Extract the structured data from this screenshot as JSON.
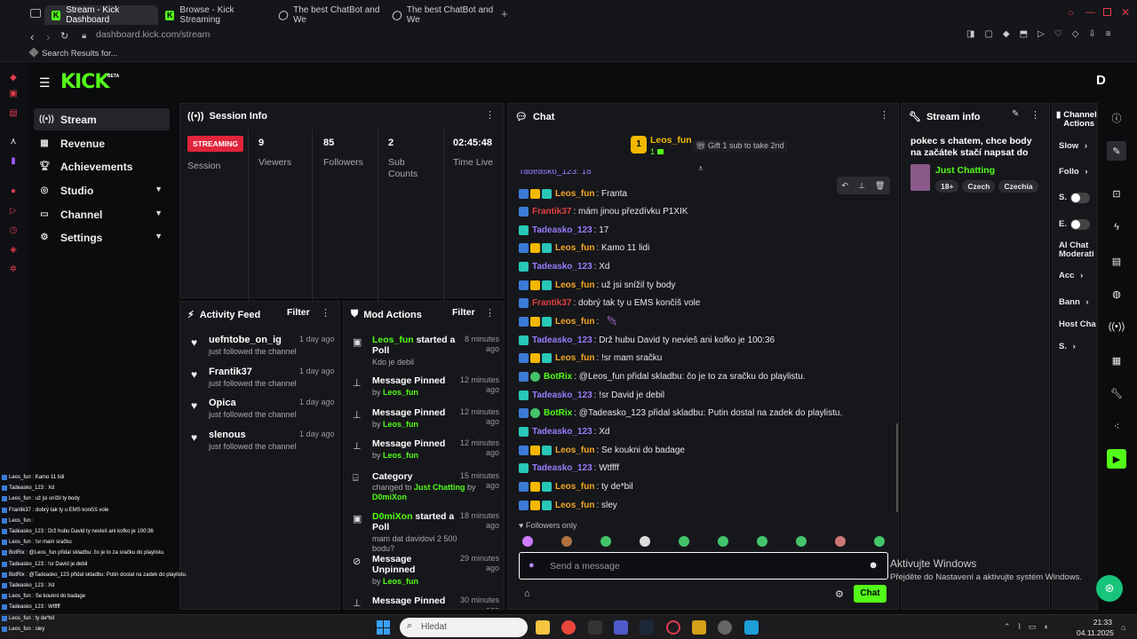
{
  "browser": {
    "tabs": [
      {
        "label": "Stream - Kick Dashboard",
        "active": true
      },
      {
        "label": "Browse - Kick Streaming",
        "active": false
      },
      {
        "label": "The best ChatBot and We",
        "active": false
      },
      {
        "label": "The best ChatBot and We",
        "active": false
      }
    ],
    "url_host": "dashboard.kick.com",
    "url_path": "/stream",
    "bookmark": "Search Results for..."
  },
  "header": {
    "logo": "KICK",
    "beta": "BETA",
    "avatar": "D"
  },
  "nav": [
    {
      "label": "Stream",
      "icon": "stream-icon",
      "active": true
    },
    {
      "label": "Revenue",
      "icon": "revenue-icon"
    },
    {
      "label": "Achievements",
      "icon": "trophy-icon"
    },
    {
      "label": "Studio",
      "icon": "studio-icon",
      "expandable": true
    },
    {
      "label": "Channel",
      "icon": "channel-icon",
      "expandable": true
    },
    {
      "label": "Settings",
      "icon": "gear-icon",
      "expandable": true
    }
  ],
  "session": {
    "title": "Session Info",
    "status_badge": "STREAMING",
    "session_label": "Session",
    "stats": [
      {
        "value": "9",
        "label": "Viewers"
      },
      {
        "value": "85",
        "label": "Followers"
      },
      {
        "value": "2",
        "label": "Sub Counts"
      },
      {
        "value": "02:45:48",
        "label": "Time Live"
      }
    ]
  },
  "activity": {
    "title": "Activity Feed",
    "filter": "Filter",
    "items": [
      {
        "name": "uefntobe_on_ig",
        "sub": "just followed the channel",
        "time": "1 day ago"
      },
      {
        "name": "Frantik37",
        "sub": "just followed the channel",
        "time": "1 day ago"
      },
      {
        "name": "Opica",
        "sub": "just followed the channel",
        "time": "1 day ago"
      },
      {
        "name": "slenous",
        "sub": "just followed the channel",
        "time": "1 day ago"
      }
    ]
  },
  "mod": {
    "title": "Mod Actions",
    "filter": "Filter",
    "items": [
      {
        "user": "Leos_fun",
        "action": " started a Poll",
        "sub": "Kdo je debil",
        "time": "8 minutes ago"
      },
      {
        "action": "Message Pinned",
        "by": "by ",
        "byuser": "Leos_fun",
        "time": "12 minutes ago"
      },
      {
        "action": "Message Pinned",
        "by": "by ",
        "byuser": "Leos_fun",
        "time": "12 minutes ago"
      },
      {
        "action": "Message Pinned",
        "by": "by ",
        "byuser": "Leos_fun",
        "time": "12 minutes ago"
      },
      {
        "action": "Category",
        "sub1": "changed to ",
        "cat": "Just Chatting",
        "sub2": " by",
        "byuser": "D0miXon",
        "time": "15 minutes ago"
      },
      {
        "user": "D0miXon",
        "action": " started a Poll",
        "sub": "mam dat davidovi 2 500 bodu?",
        "time": "18 minutes ago"
      },
      {
        "action": "Message Unpinned",
        "by": "by ",
        "byuser": "Leos_fun",
        "time": "29 minutes ago"
      },
      {
        "action": "Message Pinned",
        "time": "30 minutes ago"
      }
    ]
  },
  "chat": {
    "title": "Chat",
    "top_user": "Leos_fun",
    "top_count": "1",
    "gift_text": "Gift 1 sub to take 2nd",
    "partial_top": "Tadeasko_123: 18",
    "messages": [
      {
        "user": "Leos_fun",
        "cls": "u-leo",
        "badges": [
          "b1",
          "b2",
          "b3"
        ],
        "text": ": Franta"
      },
      {
        "user": "Frantik37",
        "cls": "u-fr",
        "badges": [
          "b1"
        ],
        "text": ": mám jinou přezdívku P1XIK"
      },
      {
        "user": "Tadeasko_123",
        "cls": "u-tad",
        "badges": [
          "b3"
        ],
        "text": ": 17"
      },
      {
        "user": "Leos_fun",
        "cls": "u-leo",
        "badges": [
          "b1",
          "b2",
          "b3"
        ],
        "text": ": Kamo 11 lidi"
      },
      {
        "user": "Tadeasko_123",
        "cls": "u-tad",
        "badges": [
          "b3"
        ],
        "text": ": Xd"
      },
      {
        "user": "Leos_fun",
        "cls": "u-leo",
        "badges": [
          "b1",
          "b2",
          "b3"
        ],
        "text": ": už jsi snížil ty body"
      },
      {
        "user": "Frantik37",
        "cls": "u-fr",
        "badges": [
          "b1"
        ],
        "text": ": dobrý tak ty u EMS končíš vole"
      },
      {
        "user": "Leos_fun",
        "cls": "u-leo",
        "badges": [
          "b1",
          "b2",
          "b3"
        ],
        "text": ":"
      },
      {
        "user": "Tadeasko_123",
        "cls": "u-tad",
        "badges": [
          "b3"
        ],
        "text": ": Drž hubu David ty nevieš ani kofko je 100:36"
      },
      {
        "user": "Leos_fun",
        "cls": "u-leo",
        "badges": [
          "b1",
          "b2",
          "b3"
        ],
        "text": ": !sr mam sračku"
      },
      {
        "user": "BotRix",
        "cls": "u-bot",
        "badges": [
          "b1",
          "b4"
        ],
        "text": ": @Leos_fun přidal skladbu: čo je to za sračku do playlistu."
      },
      {
        "user": "Tadeasko_123",
        "cls": "u-tad",
        "badges": [
          "b3"
        ],
        "text": ": !sr David je debil"
      },
      {
        "user": "BotRix",
        "cls": "u-bot",
        "badges": [
          "b1",
          "b4"
        ],
        "text": ": @Tadeasko_123 přidal skladbu: Putin dostal na zadek do playlistu."
      },
      {
        "user": "Tadeasko_123",
        "cls": "u-tad",
        "badges": [
          "b3"
        ],
        "text": ": Xd"
      },
      {
        "user": "Leos_fun",
        "cls": "u-leo",
        "badges": [
          "b1",
          "b2",
          "b3"
        ],
        "text": ": Se koukni do badage"
      },
      {
        "user": "Tadeasko_123",
        "cls": "u-tad",
        "badges": [
          "b3"
        ],
        "text": ": Wtffff"
      },
      {
        "user": "Leos_fun",
        "cls": "u-leo",
        "badges": [
          "b1",
          "b2",
          "b3"
        ],
        "text": ": ty de*bil"
      },
      {
        "user": "Leos_fun",
        "cls": "u-leo",
        "badges": [
          "b1",
          "b2",
          "b3"
        ],
        "text": ": sley"
      }
    ],
    "followers_only": "Followers only",
    "placeholder": "Send a message",
    "send": "Chat"
  },
  "stream_info": {
    "title": "Stream info",
    "stream_title": "pokec s chatem, chce body na začátek stačí napsat do chatu...",
    "category": "Just Chatting",
    "tags": [
      "18+",
      "Czech",
      "Czechia"
    ]
  },
  "channel_actions": {
    "title": "Channel Actions",
    "items": [
      "Slow",
      "Follo",
      "S.",
      "E.",
      "AI Chat Moderati",
      "Acc",
      "Bann",
      "Host Cha",
      "S."
    ]
  },
  "windows_watermark": {
    "line1": "Aktivujte Windows",
    "line2": "Přejděte do Nastavení a aktivujte systém Windows."
  },
  "overlay_chat": [
    "Leos_fun : Kamo 11 lidi",
    "Tadeasko_123 : Xd",
    "Leos_fun : už jsi snížil ty body",
    "Frantik37 : dobrý tak ty u EMS končíš vole",
    "Leos_fun :",
    "Tadeasko_123 : Drž hubu David ty nevieš ani kofko je 100:36",
    "Leos_fun : !sr mam sračku",
    "BotRix : @Leos_fun přidal skladbu: čo je to za sračku do playlistu.",
    "Tadeasko_123 : !sr David je debil",
    "BotRix : @Tadeasko_123 přidal skladbu: Putin dostal na zadek do playlistu.",
    "Tadeasko_123 : Xd",
    "Leos_fun : Se koukni do badage",
    "Tadeasko_123 : Wtffff",
    "Leos_fun : ty de*bil",
    "Leos_fun : sley"
  ],
  "taskbar": {
    "search": "Hledat",
    "time": "21:33",
    "date": "04.11.2025"
  }
}
